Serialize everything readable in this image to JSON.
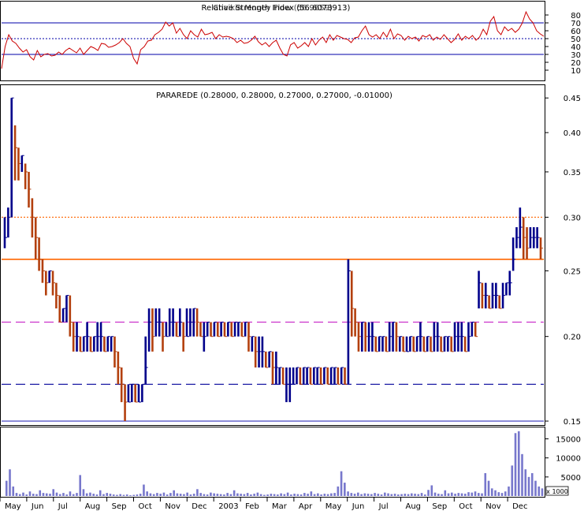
{
  "chart_data": [
    {
      "type": "line",
      "title": "Relative Strength Index (56.6073913)",
      "title_overlay": "Chaikin Money Flow (56.9659)",
      "ylim": [
        0,
        90
      ],
      "yticks": [
        10,
        20,
        30,
        40,
        50,
        60,
        70,
        80
      ],
      "reference_lines": [
        {
          "value": 70,
          "style": "solid",
          "color": "#0000aa"
        },
        {
          "value": 50,
          "style": "dotted",
          "color": "#0000aa"
        },
        {
          "value": 30,
          "style": "solid",
          "color": "#0000aa"
        }
      ],
      "series": [
        {
          "color": "#cc0000",
          "values": [
            12,
            40,
            55,
            47,
            44,
            38,
            33,
            36,
            27,
            23,
            35,
            27,
            30,
            31,
            28,
            29,
            33,
            30,
            35,
            38,
            35,
            32,
            38,
            30,
            35,
            40,
            38,
            35,
            44,
            43,
            39,
            40,
            42,
            45,
            50,
            44,
            40,
            25,
            18,
            36,
            40,
            47,
            48,
            55,
            58,
            62,
            71,
            66,
            70,
            57,
            63,
            55,
            50,
            60,
            55,
            52,
            62,
            55,
            56,
            58,
            50,
            55,
            52,
            53,
            52,
            50,
            45,
            48,
            44,
            45,
            48,
            53,
            46,
            42,
            45,
            40,
            45,
            48,
            38,
            30,
            28,
            42,
            45,
            38,
            41,
            45,
            40,
            50,
            42,
            48,
            52,
            45,
            55,
            48,
            54,
            52,
            50,
            49,
            45,
            51,
            52,
            60,
            66,
            55,
            52,
            55,
            50,
            58,
            52,
            62,
            50,
            56,
            54,
            48,
            53,
            50,
            52,
            47,
            54,
            52,
            55,
            48,
            52,
            49,
            55,
            50,
            45,
            49,
            56,
            48,
            53,
            50,
            54,
            48,
            52,
            62,
            55,
            72,
            78,
            60,
            55,
            65,
            60,
            63,
            58,
            62,
            70,
            84,
            75,
            70,
            60,
            56,
            53
          ]
        }
      ]
    },
    {
      "type": "bar",
      "title": "PARAREDE (0.28000, 0.28000, 0.27000, 0.27000, -0.01000)",
      "ylim": [
        0.148,
        0.47
      ],
      "yticks": [
        0.15,
        0.2,
        0.25,
        0.3,
        0.35,
        0.4,
        0.45
      ],
      "reference_lines": [
        {
          "value": 0.3,
          "style": "dotted",
          "color": "#ff6600"
        },
        {
          "value": 0.26,
          "style": "solid",
          "color": "#ff6600"
        },
        {
          "value": 0.21,
          "style": "dashed",
          "color": "#cc33cc"
        },
        {
          "value": 0.17,
          "style": "dashed",
          "color": "#000099"
        },
        {
          "value": 0.15,
          "style": "solid",
          "color": "#6666cc"
        }
      ],
      "series": [
        {
          "name": "close",
          "values": [
            0.28,
            0.3,
            0.45,
            0.38,
            0.36,
            0.37,
            0.35,
            0.33,
            0.3,
            0.28,
            0.26,
            0.25,
            0.24,
            0.25,
            0.24,
            0.23,
            0.21,
            0.22,
            0.23,
            0.21,
            0.2,
            0.2,
            0.19,
            0.2,
            0.2,
            0.19,
            0.2,
            0.2,
            0.2,
            0.19,
            0.2,
            0.2,
            0.19,
            0.18,
            0.17,
            0.16,
            0.16,
            0.17,
            0.16,
            0.16,
            0.17,
            0.18,
            0.21,
            0.2,
            0.21,
            0.21,
            0.2,
            0.2,
            0.21,
            0.21,
            0.2,
            0.21,
            0.2,
            0.2,
            0.21,
            0.22,
            0.21,
            0.2,
            0.2,
            0.21,
            0.2,
            0.21,
            0.2,
            0.21,
            0.2,
            0.21,
            0.2,
            0.21,
            0.21,
            0.2,
            0.21,
            0.2,
            0.2,
            0.19,
            0.19,
            0.19,
            0.18,
            0.19,
            0.18,
            0.18,
            0.18,
            0.17,
            0.17,
            0.17,
            0.17,
            0.18,
            0.17,
            0.18,
            0.18,
            0.17,
            0.18,
            0.18,
            0.17,
            0.18,
            0.17,
            0.18,
            0.18,
            0.17,
            0.18,
            0.17,
            0.25,
            0.22,
            0.21,
            0.2,
            0.21,
            0.2,
            0.2,
            0.2,
            0.19,
            0.2,
            0.2,
            0.19,
            0.2,
            0.21,
            0.2,
            0.2,
            0.19,
            0.19,
            0.2,
            0.19,
            0.2,
            0.2,
            0.19,
            0.2,
            0.19,
            0.2,
            0.2,
            0.19,
            0.2,
            0.2,
            0.19,
            0.2,
            0.2,
            0.2,
            0.19,
            0.2,
            0.21,
            0.2,
            0.24,
            0.23,
            0.23,
            0.22,
            0.23,
            0.23,
            0.22,
            0.23,
            0.24,
            0.24,
            0.26,
            0.28,
            0.29,
            0.28,
            0.27,
            0.28,
            0.28,
            0.28,
            0.27
          ]
        },
        {
          "name": "high",
          "values": [
            0.3,
            0.31,
            0.45,
            0.41,
            0.38,
            0.37,
            0.36,
            0.35,
            0.32,
            0.3,
            0.28,
            0.26,
            0.25,
            0.25,
            0.25,
            0.24,
            0.23,
            0.22,
            0.23,
            0.23,
            0.21,
            0.21,
            0.2,
            0.2,
            0.21,
            0.2,
            0.2,
            0.21,
            0.21,
            0.2,
            0.2,
            0.2,
            0.2,
            0.19,
            0.18,
            0.17,
            0.17,
            0.17,
            0.17,
            0.17,
            0.17,
            0.2,
            0.22,
            0.22,
            0.22,
            0.22,
            0.21,
            0.21,
            0.22,
            0.22,
            0.21,
            0.22,
            0.21,
            0.22,
            0.22,
            0.22,
            0.22,
            0.21,
            0.21,
            0.21,
            0.21,
            0.21,
            0.21,
            0.21,
            0.21,
            0.21,
            0.21,
            0.21,
            0.21,
            0.21,
            0.21,
            0.21,
            0.2,
            0.2,
            0.2,
            0.2,
            0.19,
            0.19,
            0.19,
            0.19,
            0.18,
            0.18,
            0.18,
            0.18,
            0.18,
            0.18,
            0.18,
            0.18,
            0.18,
            0.18,
            0.18,
            0.18,
            0.18,
            0.18,
            0.18,
            0.18,
            0.18,
            0.18,
            0.18,
            0.18,
            0.26,
            0.25,
            0.22,
            0.21,
            0.21,
            0.21,
            0.21,
            0.21,
            0.2,
            0.2,
            0.2,
            0.2,
            0.21,
            0.21,
            0.21,
            0.2,
            0.2,
            0.2,
            0.2,
            0.2,
            0.2,
            0.21,
            0.2,
            0.2,
            0.2,
            0.21,
            0.21,
            0.2,
            0.2,
            0.2,
            0.2,
            0.21,
            0.21,
            0.21,
            0.2,
            0.21,
            0.21,
            0.21,
            0.25,
            0.24,
            0.24,
            0.23,
            0.24,
            0.24,
            0.23,
            0.24,
            0.24,
            0.25,
            0.28,
            0.29,
            0.31,
            0.3,
            0.29,
            0.29,
            0.29,
            0.29,
            0.28
          ]
        },
        {
          "name": "low",
          "values": [
            0.27,
            0.28,
            0.3,
            0.34,
            0.34,
            0.35,
            0.33,
            0.31,
            0.28,
            0.26,
            0.25,
            0.24,
            0.23,
            0.24,
            0.23,
            0.22,
            0.21,
            0.21,
            0.21,
            0.2,
            0.19,
            0.19,
            0.19,
            0.19,
            0.19,
            0.19,
            0.19,
            0.19,
            0.19,
            0.19,
            0.19,
            0.19,
            0.18,
            0.17,
            0.16,
            0.15,
            0.16,
            0.16,
            0.16,
            0.16,
            0.16,
            0.17,
            0.19,
            0.19,
            0.2,
            0.2,
            0.19,
            0.2,
            0.2,
            0.2,
            0.2,
            0.2,
            0.19,
            0.2,
            0.2,
            0.2,
            0.2,
            0.2,
            0.19,
            0.2,
            0.2,
            0.2,
            0.2,
            0.2,
            0.2,
            0.2,
            0.2,
            0.2,
            0.2,
            0.2,
            0.2,
            0.19,
            0.19,
            0.18,
            0.18,
            0.18,
            0.18,
            0.18,
            0.17,
            0.17,
            0.17,
            0.17,
            0.16,
            0.16,
            0.17,
            0.17,
            0.17,
            0.17,
            0.17,
            0.17,
            0.17,
            0.17,
            0.17,
            0.17,
            0.17,
            0.17,
            0.17,
            0.17,
            0.17,
            0.17,
            0.17,
            0.2,
            0.2,
            0.19,
            0.19,
            0.19,
            0.19,
            0.19,
            0.19,
            0.19,
            0.19,
            0.19,
            0.19,
            0.19,
            0.19,
            0.19,
            0.19,
            0.19,
            0.19,
            0.19,
            0.19,
            0.19,
            0.19,
            0.19,
            0.19,
            0.19,
            0.19,
            0.19,
            0.19,
            0.19,
            0.19,
            0.19,
            0.19,
            0.19,
            0.19,
            0.19,
            0.2,
            0.2,
            0.22,
            0.22,
            0.22,
            0.22,
            0.22,
            0.22,
            0.22,
            0.22,
            0.23,
            0.23,
            0.25,
            0.27,
            0.27,
            0.26,
            0.26,
            0.27,
            0.27,
            0.27,
            0.26
          ]
        }
      ]
    },
    {
      "type": "bar",
      "ylim": [
        0,
        18000
      ],
      "yticks": [
        5000,
        10000,
        15000
      ],
      "unit_label": "x 1000",
      "color": "#7777cc",
      "values": [
        0,
        4000,
        7000,
        2500,
        800,
        500,
        900,
        400,
        1200,
        600,
        500,
        1500,
        800,
        700,
        600,
        1800,
        900,
        500,
        800,
        400,
        1200,
        500,
        800,
        5500,
        1800,
        700,
        900,
        600,
        400,
        1500,
        500,
        800,
        600,
        400,
        300,
        500,
        300,
        400,
        200,
        300,
        400,
        600,
        3000,
        1200,
        700,
        500,
        800,
        600,
        900,
        400,
        800,
        1500,
        700,
        600,
        500,
        900,
        400,
        600,
        1800,
        800,
        500,
        400,
        900,
        700,
        600,
        500,
        400,
        800,
        500,
        1500,
        700,
        600,
        500,
        800,
        400,
        600,
        900,
        500,
        300,
        400,
        600,
        500,
        400,
        700,
        500,
        900,
        400,
        600,
        500,
        400,
        800,
        600,
        1200,
        500,
        700,
        400,
        600,
        500,
        700,
        800,
        2500,
        6500,
        3500,
        1200,
        800,
        600,
        900,
        500,
        700,
        600,
        500,
        800,
        600,
        400,
        900,
        700,
        500,
        600,
        400,
        500,
        600,
        500,
        700,
        600,
        500,
        800,
        400,
        1600,
        2800,
        900,
        600,
        500,
        1500,
        700,
        900,
        600,
        800,
        700,
        600,
        1000,
        900,
        1200,
        800,
        700,
        6000,
        4000,
        2000,
        1500,
        1000,
        800,
        1200,
        2500,
        8000,
        16500,
        17000,
        11000,
        7000,
        5000,
        6000,
        4000,
        2500,
        2000
      ]
    }
  ],
  "x_axis": {
    "labels": [
      "May",
      "Jun",
      "Jul",
      "Aug",
      "Sep",
      "Oct",
      "Nov",
      "Dec",
      "2003",
      "Feb",
      "Mar",
      "Apr",
      "May",
      "Jun",
      "Jul",
      "Aug",
      "Sep",
      "Oct",
      "Nov",
      "Dec"
    ]
  }
}
